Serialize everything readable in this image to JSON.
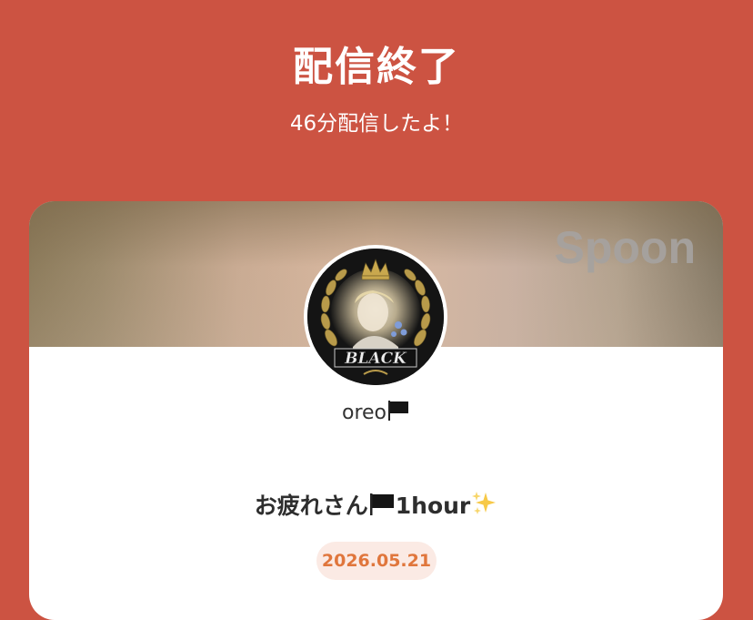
{
  "header": {
    "title": "配信終了",
    "subtitle": "46分配信したよ！"
  },
  "card": {
    "brand": "Spoon",
    "avatar_text": "BLACK",
    "username": "oreo",
    "username_icon": "black-flag-icon",
    "stream_title": "お疲れさん",
    "stream_title_suffix": "1hour",
    "stream_title_icons": [
      "black-flag-icon",
      "sparkles-icon"
    ],
    "date": "2026.05.21"
  },
  "colors": {
    "background": "#cc5342",
    "card": "#ffffff",
    "date_text": "#e0763c",
    "date_badge": "#fbeae4",
    "brand": "#a6a29f"
  }
}
